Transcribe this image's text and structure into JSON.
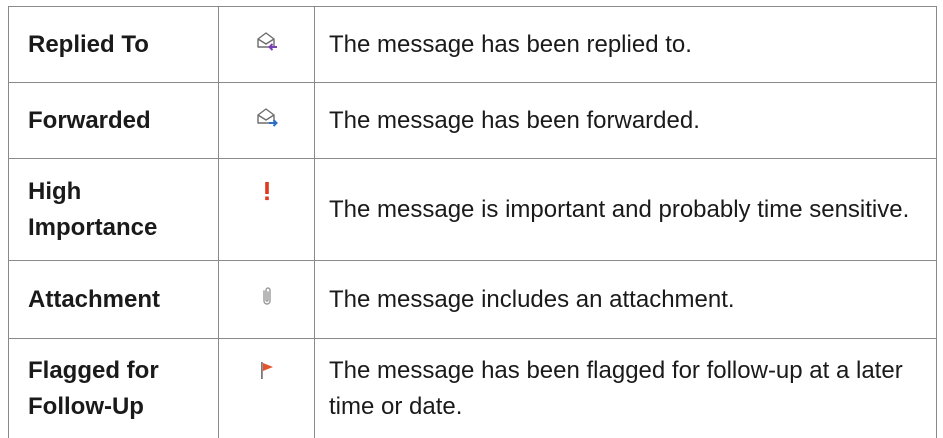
{
  "rows": [
    {
      "name": "Replied To",
      "icon": "replied-envelope-icon",
      "description": "The message has been replied to."
    },
    {
      "name": "Forwarded",
      "icon": "forwarded-envelope-icon",
      "description": "The message has been forwarded."
    },
    {
      "name": "High Importance",
      "icon": "exclamation-icon",
      "description": "The message is important and probably time sensitive."
    },
    {
      "name": "Attachment",
      "icon": "paperclip-icon",
      "description": "The message includes an attachment."
    },
    {
      "name": "Flagged for Follow-Up",
      "icon": "flag-icon",
      "description": "The message has been flagged for follow-up at a later time or date."
    }
  ],
  "colors": {
    "reply_arrow": "#7b3fb5",
    "forward_arrow": "#2e6fc4",
    "importance": "#e03a1e",
    "flag": "#e5532b",
    "border": "#8a8a8a"
  }
}
